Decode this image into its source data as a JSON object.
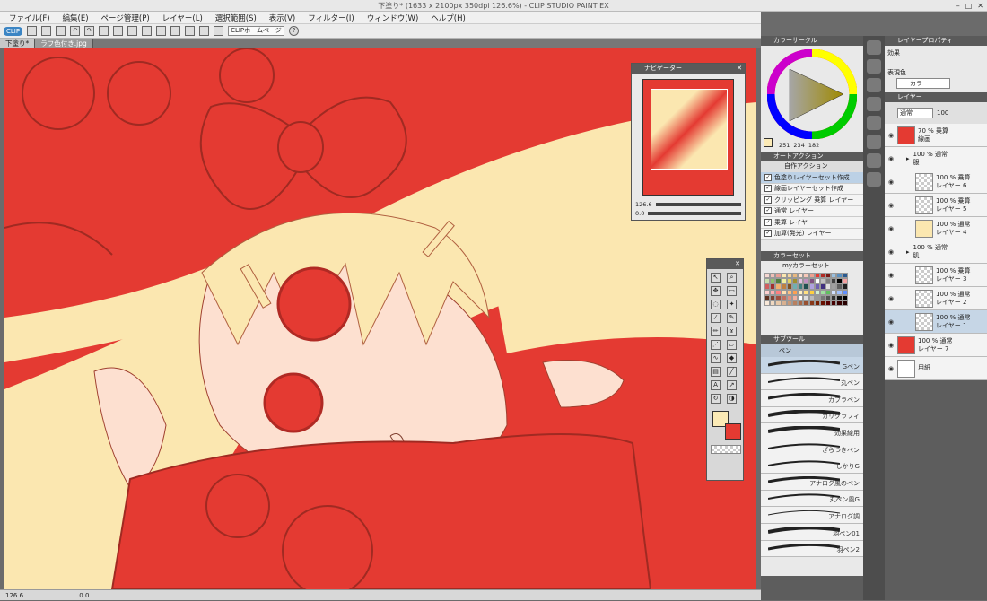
{
  "window": {
    "title": "下塗り* (1633 x 2100px 350dpi 126.6%)  - CLIP STUDIO PAINT EX",
    "controls": [
      "–",
      "□",
      "✕"
    ]
  },
  "menu": [
    "ファイル(F)",
    "編集(E)",
    "ページ管理(P)",
    "レイヤー(L)",
    "選択範囲(S)",
    "表示(V)",
    "フィルター(I)",
    "ウィンドウ(W)",
    "ヘルプ(H)"
  ],
  "toolbar": {
    "logo": "CLIP",
    "home": "CLIPホームページ",
    "help": "?"
  },
  "tabs": [
    "下塗り*",
    "ラフ色付き.jpg"
  ],
  "status": {
    "zoom": "126.6",
    "rotate": "0.0"
  },
  "navigator": {
    "title": "ナビゲーター",
    "zoom": "126.6",
    "angle": "0.0"
  },
  "colorwheel": {
    "title": "カラーサークル",
    "r": "251",
    "g": "234",
    "b": "182"
  },
  "autoaction": {
    "title": "オートアクション",
    "set": "自作アクション",
    "items": [
      "色塗りレイヤーセット作成",
      "線画レイヤーセット作成",
      "クリッピング 乗算 レイヤー",
      "通常 レイヤー",
      "乗算 レイヤー",
      "加算(発光) レイヤー"
    ]
  },
  "colorset": {
    "title": "カラーセット",
    "set": "myカラーセット"
  },
  "subtool": {
    "title": "サブツール",
    "group": "ペン",
    "brushes": [
      "Gペン",
      "丸ペン",
      "カブラペン",
      "カリグラフィ",
      "効果線用",
      "ざらつきペン",
      "しかりG",
      "アナログ風のペン",
      "丸ペン風G",
      "アナログ調",
      "羽ペン01",
      "羽ペン2"
    ]
  },
  "layerprop": {
    "title": "レイヤープロパティ",
    "effect": "効果",
    "displaycolor": "表現色",
    "color": "カラー"
  },
  "layers": {
    "title": "レイヤー",
    "blend": "通常",
    "opacity": "100",
    "items": [
      {
        "pct": "70 %",
        "mode": "乗算",
        "name": "線画"
      },
      {
        "pct": "100 %",
        "mode": "通常",
        "name": "服"
      },
      {
        "pct": "100 %",
        "mode": "乗算",
        "name": "レイヤー 6"
      },
      {
        "pct": "100 %",
        "mode": "乗算",
        "name": "レイヤー 5"
      },
      {
        "pct": "100 %",
        "mode": "通常",
        "name": "レイヤー 4"
      },
      {
        "pct": "100 %",
        "mode": "通常",
        "name": "肌"
      },
      {
        "pct": "100 %",
        "mode": "乗算",
        "name": "レイヤー 3"
      },
      {
        "pct": "100 %",
        "mode": "通常",
        "name": "レイヤー 2"
      },
      {
        "pct": "100 %",
        "mode": "通常",
        "name": "レイヤー 1"
      },
      {
        "pct": "100 %",
        "mode": "通常",
        "name": "レイヤー 7"
      },
      {
        "pct": "",
        "mode": "",
        "name": "用紙"
      }
    ]
  },
  "colors": {
    "main": "#fbeab6",
    "sub": "#e43a32",
    "red": "#e43a32",
    "hair": "#fbe7b0",
    "skin": "#fde0d0"
  }
}
